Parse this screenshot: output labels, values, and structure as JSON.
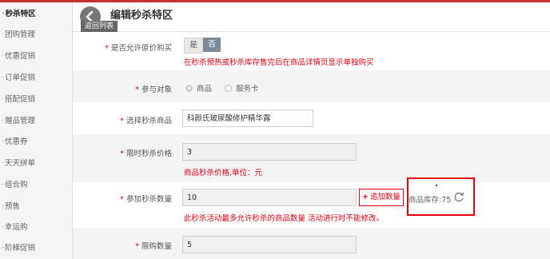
{
  "sidebar": {
    "items": [
      {
        "label": "秒杀特区",
        "active": true
      },
      {
        "label": "团购管理"
      },
      {
        "label": "优惠促销"
      },
      {
        "label": "订单促销"
      },
      {
        "label": "搭配促销"
      },
      {
        "label": "赠品管理"
      },
      {
        "label": "优惠券"
      },
      {
        "label": "天天拼单"
      },
      {
        "label": "组合购"
      },
      {
        "label": "预售"
      },
      {
        "label": "幸运购"
      },
      {
        "label": "阶梯促销"
      }
    ]
  },
  "header": {
    "title": "编辑秒杀特区",
    "back_label": "返回列表"
  },
  "form": {
    "original_price": {
      "label": "是否允许原价购买",
      "yes": "是",
      "no": "否",
      "selected": "否",
      "hint": "在秒杀预热或秒杀库存售完后在商品详情页显示单独购买"
    },
    "target": {
      "label": "参与对象",
      "options": [
        "商品",
        "服务卡"
      ],
      "selected": "商品"
    },
    "product": {
      "label": "选择秒杀商品",
      "value": "科颜氏玻尿酸修护精华露"
    },
    "price": {
      "label": "限时秒杀价格",
      "value": "3",
      "hint": "商品秒杀价格,单位：元"
    },
    "quantity": {
      "label": "参加秒杀数量",
      "value": "10",
      "add_label": "追加数量",
      "stock_text": "商品库存:75",
      "hint": "此秒杀活动最多允许秒杀的商品数量 活动进行时不能修改。"
    },
    "limit": {
      "label": "限购数量",
      "value": "5"
    }
  },
  "colors": {
    "accent": "#e60012",
    "topbar": "#c9302c",
    "toggle_selected": "#7a8c99"
  }
}
